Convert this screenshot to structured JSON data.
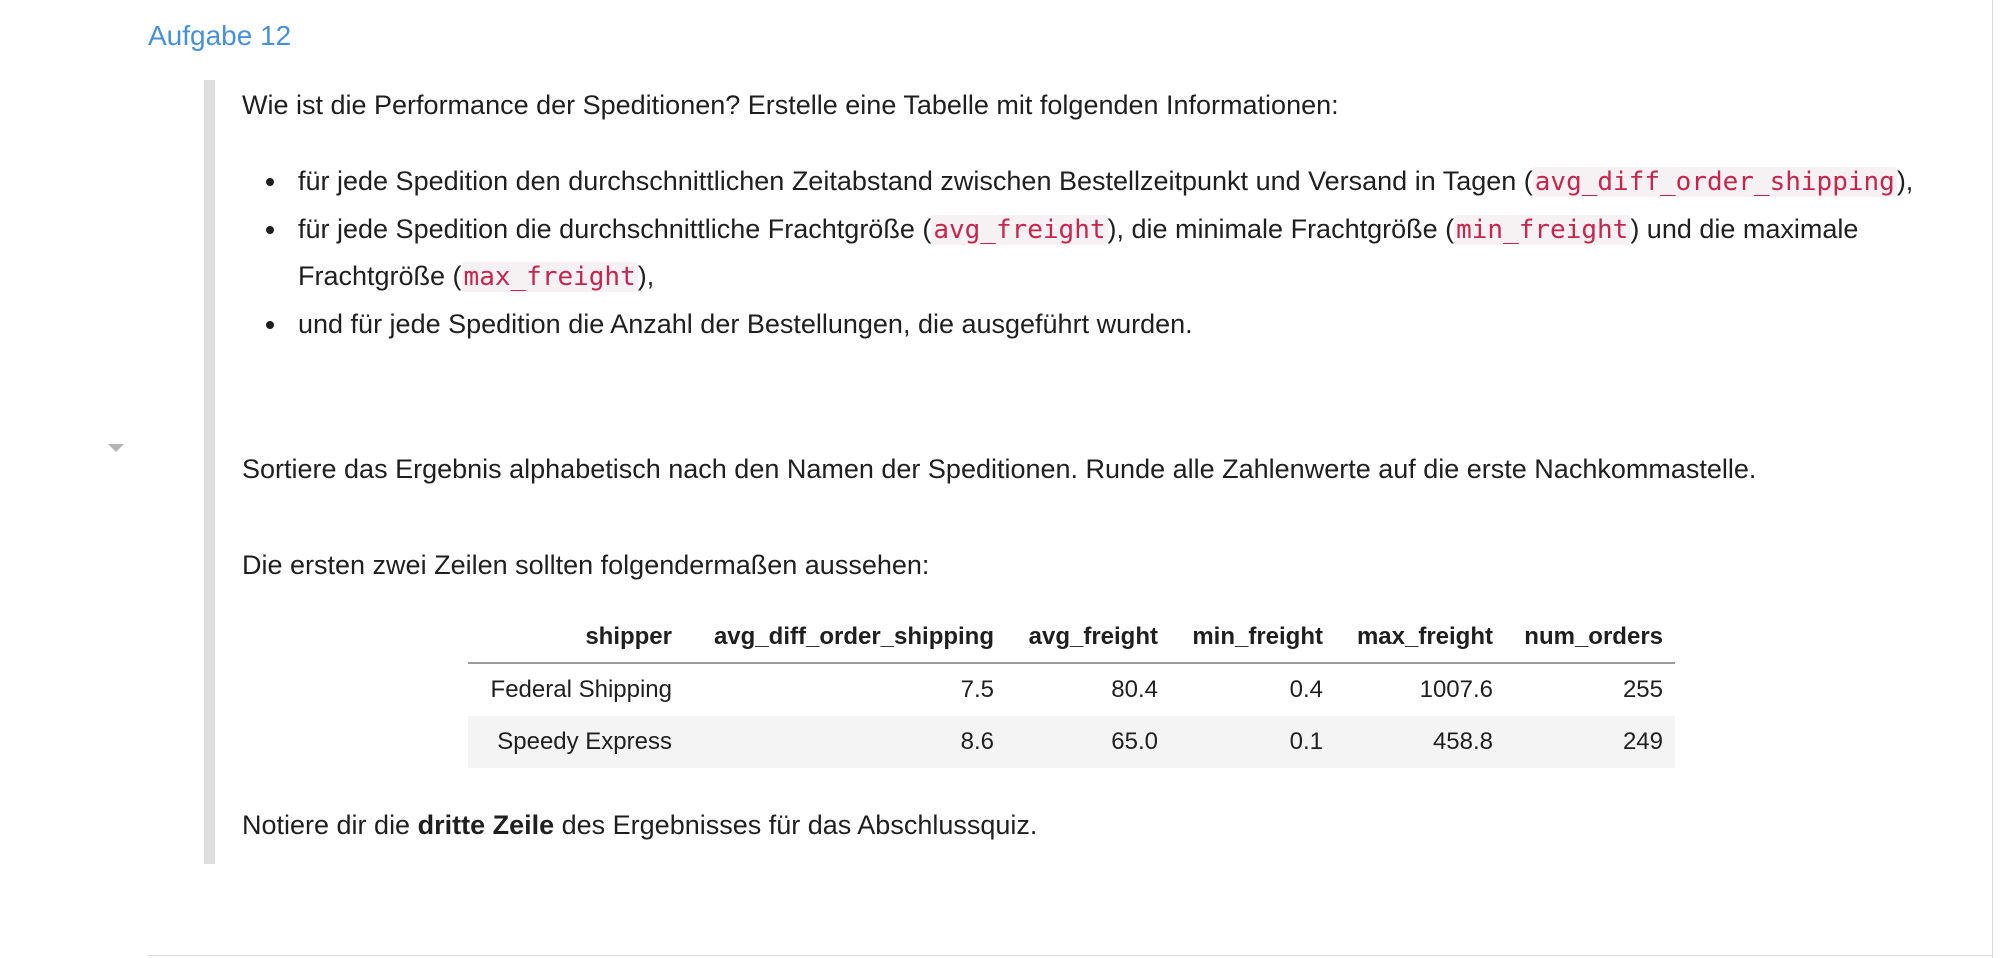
{
  "task": {
    "heading": "Aufgabe 12",
    "intro": "Wie ist die Performance der Speditionen? Erstelle eine Tabelle mit folgenden Informationen:",
    "bullets": [
      {
        "before": "für jede Spedition den durchschnittlichen Zeitabstand zwischen Bestellzeitpunkt und Versand in Tagen (",
        "code": "avg_diff_order_shipping",
        "after": "),"
      },
      {
        "before": "für jede Spedition die durchschnittliche Frachtgröße (",
        "code1": "avg_freight",
        "middle1": "), die minimale Frachtgröße (",
        "code2": "min_freight",
        "middle2": ") und die maximale Frachtgröße (",
        "code3": "max_freight",
        "after": "),"
      },
      {
        "text": "und für jede Spedition die Anzahl der Bestellungen, die ausgeführt wurden."
      }
    ],
    "sort_note": "Sortiere das Ergebnis alphabetisch nach den Namen der Speditionen. Runde alle Zahlenwerte auf die erste Nachkommastelle.",
    "rows_note": "Die ersten zwei Zeilen sollten folgendermaßen aussehen:",
    "final_note": {
      "before": "Notiere dir die ",
      "bold": "dritte Zeile",
      "after": " des Ergebnisses für das Abschlussquiz."
    }
  },
  "table": {
    "columns": [
      "shipper",
      "avg_diff_order_shipping",
      "avg_freight",
      "min_freight",
      "max_freight",
      "num_orders"
    ],
    "rows": [
      [
        "Federal Shipping",
        "7.5",
        "80.4",
        "0.4",
        "1007.6",
        "255"
      ],
      [
        "Speedy Express",
        "8.6",
        "65.0",
        "0.1",
        "458.8",
        "249"
      ]
    ]
  },
  "colors": {
    "heading": "#4a90d9",
    "code": "#c7254e",
    "quote_bar": "#dedede"
  },
  "icons": {
    "collapse": "chevron-down-icon"
  }
}
